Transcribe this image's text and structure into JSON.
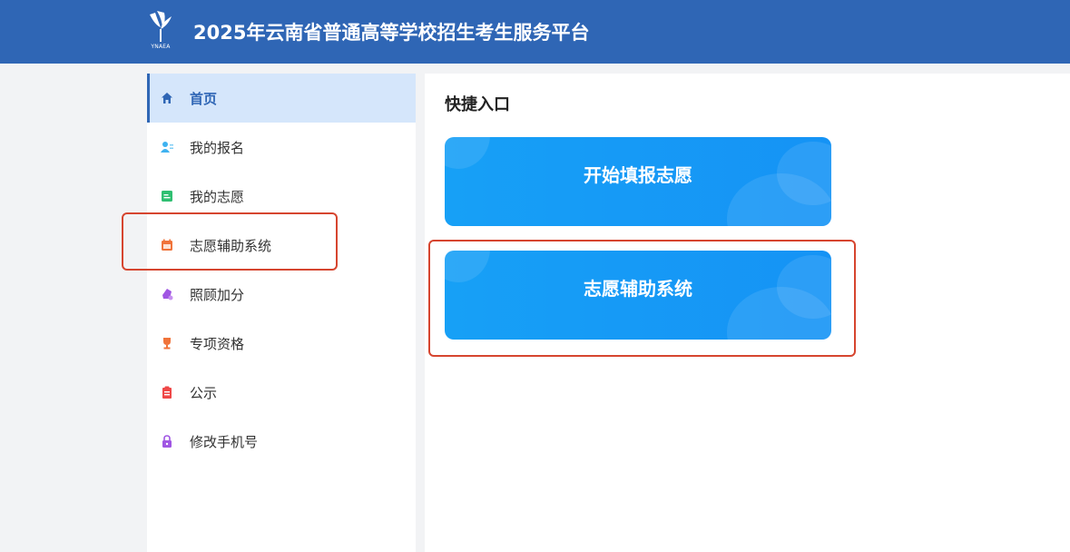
{
  "header": {
    "logo_text": "YNAEA",
    "title": "2025年云南省普通高等学校招生考生服务平台"
  },
  "sidebar": {
    "items": [
      {
        "label": "首页",
        "icon": "home-icon",
        "color": "#2f66b5",
        "active": true
      },
      {
        "label": "我的报名",
        "icon": "user-list-icon",
        "color": "#3fb2f0"
      },
      {
        "label": "我的志愿",
        "icon": "document-icon",
        "color": "#2fbf71"
      },
      {
        "label": "志愿辅助系统",
        "icon": "calendar-icon",
        "color": "#f0733a"
      },
      {
        "label": "照顾加分",
        "icon": "bonus-icon",
        "color": "#a056e3"
      },
      {
        "label": "专项资格",
        "icon": "trophy-icon",
        "color": "#f0733a"
      },
      {
        "label": "公示",
        "icon": "clipboard-icon",
        "color": "#ef4747"
      },
      {
        "label": "修改手机号",
        "icon": "lock-icon",
        "color": "#a056e3"
      }
    ]
  },
  "main": {
    "section_title": "快捷入口",
    "cards": [
      {
        "label": "开始填报志愿"
      },
      {
        "label": "志愿辅助系统"
      }
    ]
  },
  "colors": {
    "header_bg": "#2f66b5",
    "card_bg": "#1598f5",
    "highlight": "#d6452f"
  }
}
